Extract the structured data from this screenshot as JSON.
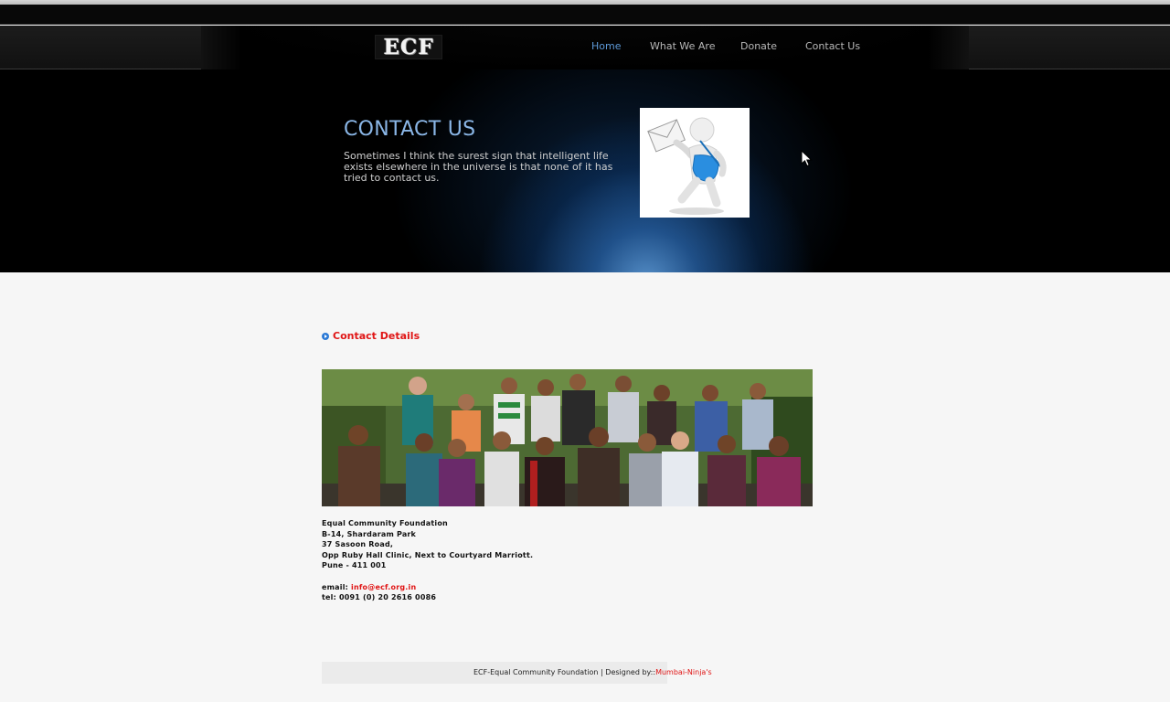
{
  "brand": {
    "logo_text": "ECF"
  },
  "nav": {
    "items": [
      {
        "label": "Home",
        "active": true
      },
      {
        "label": "What We Are",
        "active": false
      },
      {
        "label": "Donate",
        "active": false
      },
      {
        "label": "Contact Us",
        "active": false
      }
    ]
  },
  "hero": {
    "title": "CONTACT US",
    "text": "Sometimes I think the surest sign that intelligent life exists elsewhere in the universe is that none of it has tried to contact us.",
    "image_icon": "mail-carrier-figure"
  },
  "contact": {
    "heading": "Contact Details",
    "photo_icon": "team-photo",
    "address_lines": [
      "Equal Community Foundation",
      "B-14, Shardaram Park",
      "37 Sasoon Road,",
      "Opp Ruby Hall Clinic, Next to Courtyard Marriott.",
      "Pune - 411 001"
    ],
    "email_label": "email: ",
    "email": "info@ecf.org.in",
    "tel": "tel: 0091 (0) 20 2616 0086"
  },
  "footer": {
    "text": "ECF-Equal Community Foundation | Designed by::",
    "designer": "Mumbai-Ninja's"
  },
  "colors": {
    "accent_red": "#e01515",
    "nav_active": "#5d99d8",
    "hero_title": "#8ab6e6"
  }
}
